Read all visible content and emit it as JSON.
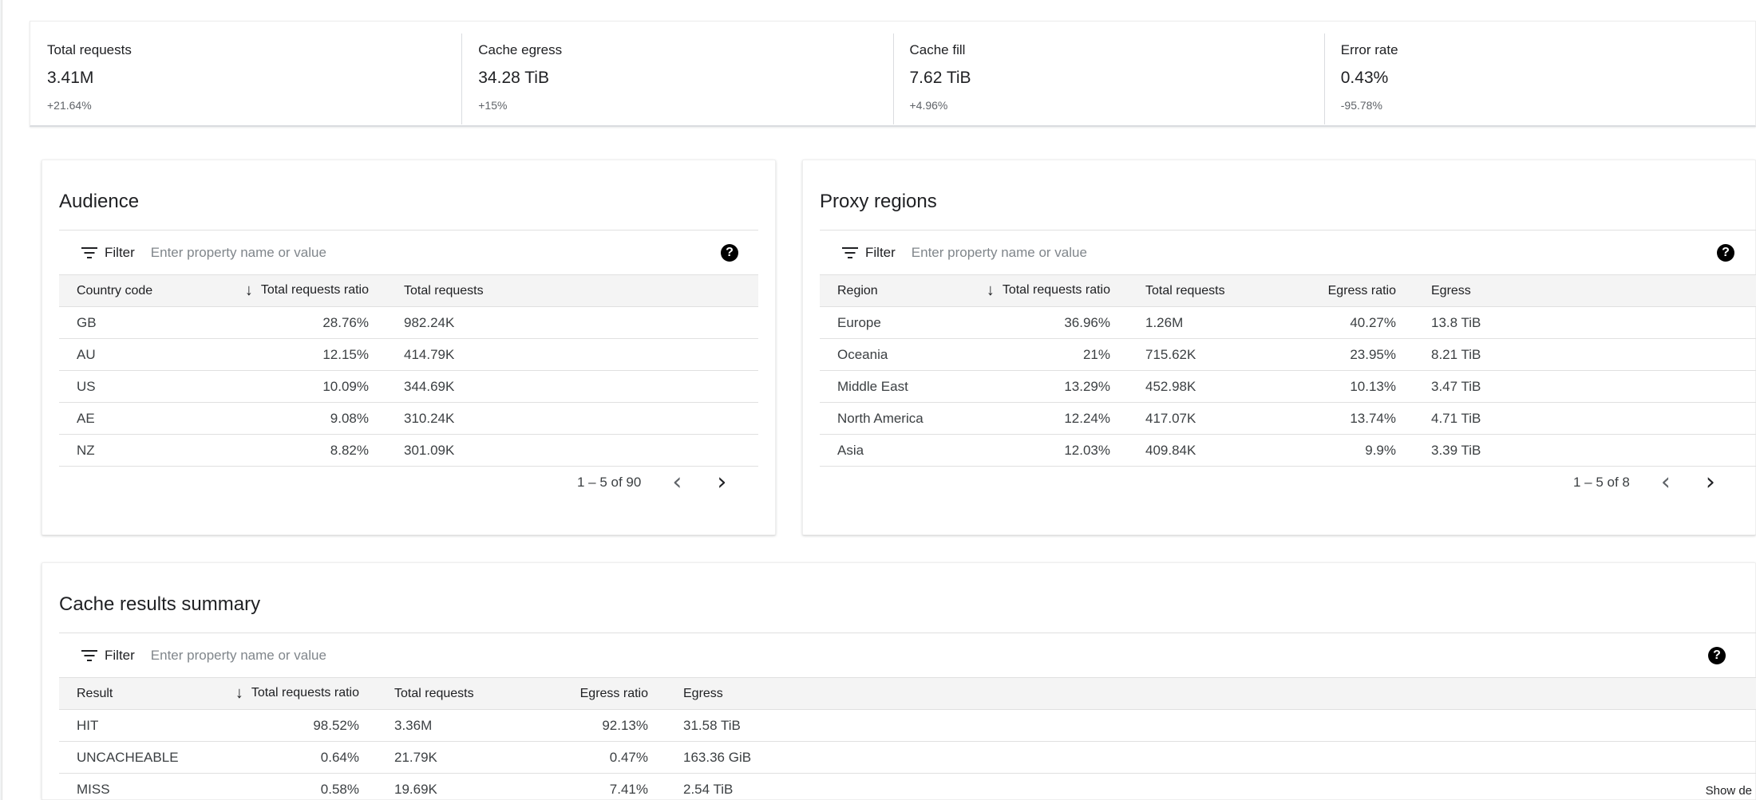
{
  "metrics": [
    {
      "label": "Total requests",
      "value": "3.41M",
      "delta": "+21.64%"
    },
    {
      "label": "Cache egress",
      "value": "34.28 TiB",
      "delta": "+15%"
    },
    {
      "label": "Cache fill",
      "value": "7.62 TiB",
      "delta": "+4.96%"
    },
    {
      "label": "Error rate",
      "value": "0.43%",
      "delta": "-95.78%"
    }
  ],
  "filter": {
    "label": "Filter",
    "placeholder": "Enter property name or value",
    "help_glyph": "?"
  },
  "audience": {
    "title": "Audience",
    "columns": [
      "Country code",
      "Total requests ratio",
      "Total requests"
    ],
    "rows": [
      [
        "GB",
        "28.76%",
        "982.24K"
      ],
      [
        "AU",
        "12.15%",
        "414.79K"
      ],
      [
        "US",
        "10.09%",
        "344.69K"
      ],
      [
        "AE",
        "9.08%",
        "310.24K"
      ],
      [
        "NZ",
        "8.82%",
        "301.09K"
      ]
    ],
    "pagination": "1 – 5 of 90"
  },
  "proxy_regions": {
    "title": "Proxy regions",
    "columns": [
      "Region",
      "Total requests ratio",
      "Total requests",
      "Egress ratio",
      "Egress"
    ],
    "rows": [
      [
        "Europe",
        "36.96%",
        "1.26M",
        "40.27%",
        "13.8 TiB"
      ],
      [
        "Oceania",
        "21%",
        "715.62K",
        "23.95%",
        "8.21 TiB"
      ],
      [
        "Middle East",
        "13.29%",
        "452.98K",
        "10.13%",
        "3.47 TiB"
      ],
      [
        "North America",
        "12.24%",
        "417.07K",
        "13.74%",
        "4.71 TiB"
      ],
      [
        "Asia",
        "12.03%",
        "409.84K",
        "9.9%",
        "3.39 TiB"
      ]
    ],
    "pagination": "1 – 5 of 8"
  },
  "cache_results": {
    "title": "Cache results summary",
    "columns": [
      "Result",
      "Total requests ratio",
      "Total requests",
      "Egress ratio",
      "Egress"
    ],
    "rows": [
      [
        "HIT",
        "98.52%",
        "3.36M",
        "92.13%",
        "31.58 TiB"
      ],
      [
        "UNCACHEABLE",
        "0.64%",
        "21.79K",
        "0.47%",
        "163.36 GiB"
      ],
      [
        "MISS",
        "0.58%",
        "19.69K",
        "7.41%",
        "2.54 TiB"
      ]
    ],
    "show_more": "Show de"
  },
  "icons": {
    "filter": "filter-list-icon",
    "help": "help-icon",
    "sort": "arrow-downward-icon",
    "prev": "chevron-left-icon",
    "next": "chevron-right-icon"
  },
  "colors": {
    "header_bg": "#f4f4f4",
    "divider": "#e0e0e0",
    "text": "#202124",
    "muted": "#5f6368"
  }
}
